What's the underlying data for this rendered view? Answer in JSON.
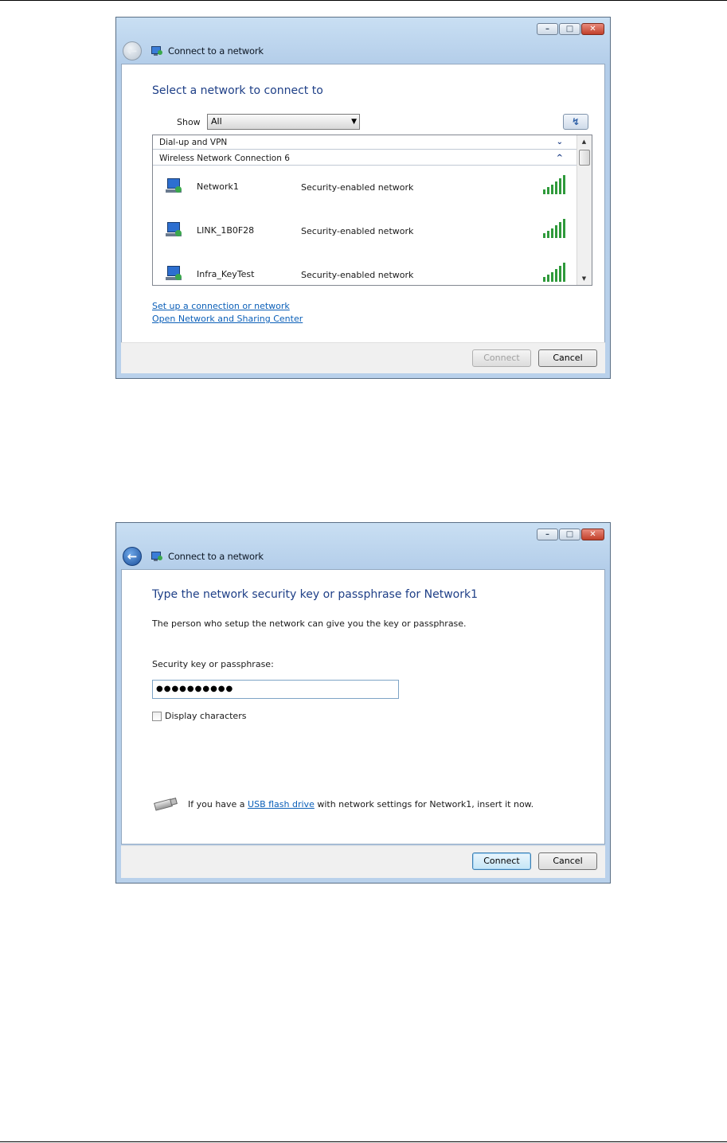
{
  "window1": {
    "title": "Connect to a network",
    "heading": "Select a network to connect to",
    "show_label": "Show",
    "show_value": "All",
    "groups": [
      {
        "label": "Dial-up and VPN",
        "chevron": "⌄"
      },
      {
        "label": "Wireless Network Connection 6",
        "chevron": "^"
      }
    ],
    "networks": [
      {
        "name": "Network1",
        "security": "Security-enabled network"
      },
      {
        "name": "LINK_1B0F28",
        "security": "Security-enabled network"
      },
      {
        "name": "Infra_KeyTest",
        "security": "Security-enabled network"
      }
    ],
    "links": [
      "Set up a connection or network",
      "Open Network and Sharing Center"
    ],
    "connect_label": "Connect",
    "cancel_label": "Cancel"
  },
  "window2": {
    "title": "Connect to a network",
    "heading": "Type the network security key or passphrase for Network1",
    "description": "The person who setup the network can give you the key or passphrase.",
    "key_label": "Security key or passphrase:",
    "key_value": "●●●●●●●●●●",
    "display_chars_label": "Display characters",
    "display_chars_checked": false,
    "usb_text_before": "If you have a ",
    "usb_link": "USB flash drive",
    "usb_text_after": " with network settings for Network1, insert it now.",
    "connect_label": "Connect",
    "cancel_label": "Cancel"
  },
  "icons": {
    "minimize": "minimize-icon",
    "maximize": "maximize-icon",
    "close": "close-icon",
    "back": "back-arrow-icon",
    "network": "network-icon",
    "signal": "signal-strength-icon",
    "refresh": "refresh-icon",
    "usb": "usb-drive-icon"
  },
  "colors": {
    "heading": "#1e3f87",
    "link": "#0b5fb8",
    "signal": "#2f9a3b",
    "close_button": "#c1402b"
  }
}
